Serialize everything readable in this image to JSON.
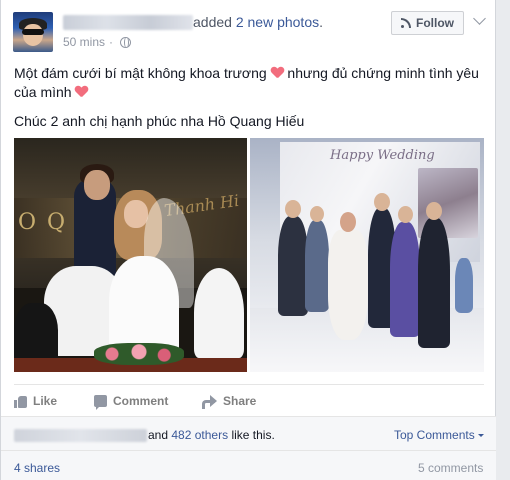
{
  "post": {
    "action_suffix": "added",
    "action_link": "2 new photos",
    "action_period": ".",
    "time": "50 mins",
    "time_separator": "·",
    "follow_label": "Follow",
    "text_line1_a": "Một đám cưới bí mật không khoa trương",
    "text_line1_b": " nhưng đủ chứng minh tình yêu của mình",
    "text_line2": "Chúc 2 anh chị hạnh phúc nha Hồ Quang Hiếu",
    "photo_left_text": "O Q",
    "photo_left_script": "Thanh Hi",
    "photo_right_text": "Happy Wedding"
  },
  "actions": {
    "like_label": "Like",
    "comment_label": "Comment",
    "share_label": "Share"
  },
  "footer": {
    "likes_and": "and",
    "likes_others": "482 others",
    "likes_suffix": "like this.",
    "top_comments": "Top Comments",
    "shares": "4 shares",
    "comments": "5 comments"
  },
  "colors": {
    "link": "#3b5998",
    "muted": "#9197a3",
    "heart": "#f26d7d"
  }
}
